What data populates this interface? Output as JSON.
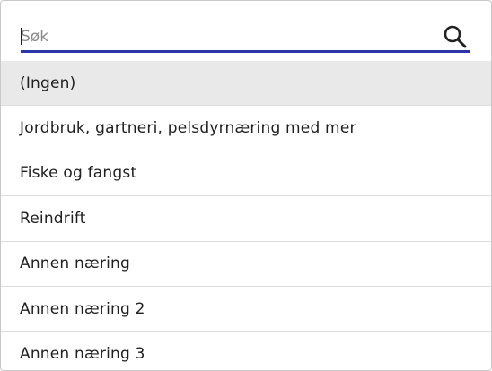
{
  "search": {
    "placeholder": "Søk",
    "value": "",
    "icon": "search-icon"
  },
  "colors": {
    "accent": "#2b35a8",
    "selected_bg": "#e9e9e9",
    "divider": "#dedede"
  },
  "list": {
    "selected_index": 0,
    "items": [
      {
        "label": "(Ingen)"
      },
      {
        "label": "Jordbruk, gartneri, pelsdyrnæring med mer"
      },
      {
        "label": "Fiske og fangst"
      },
      {
        "label": "Reindrift"
      },
      {
        "label": "Annen næring"
      },
      {
        "label": "Annen næring 2"
      },
      {
        "label": "Annen næring 3"
      }
    ]
  }
}
